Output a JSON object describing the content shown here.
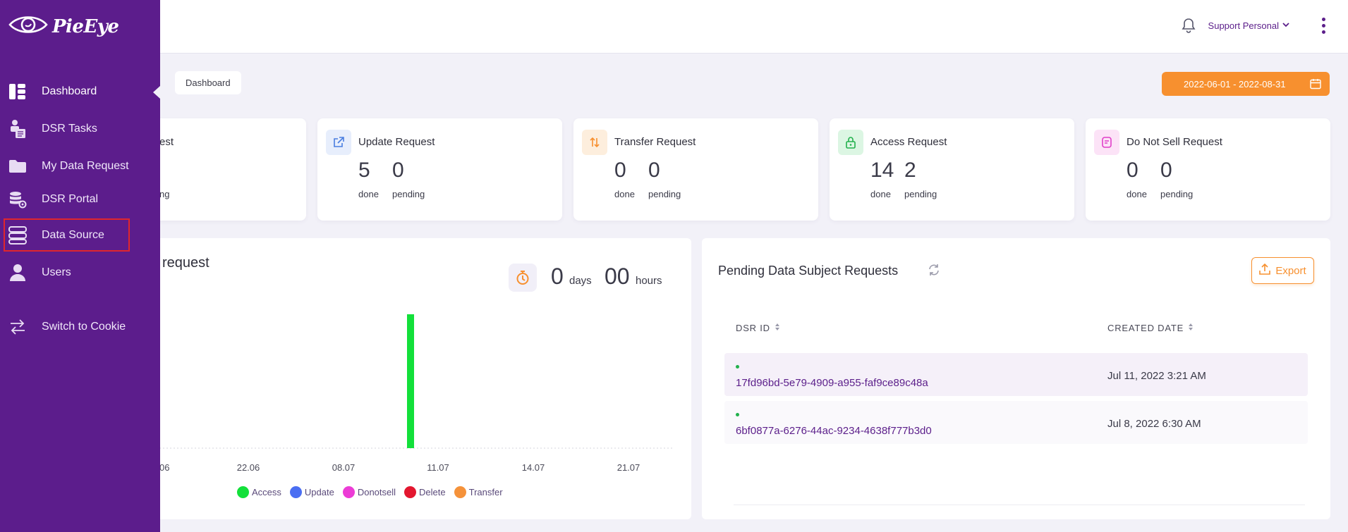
{
  "app": {
    "logo_text": "PieEye"
  },
  "header": {
    "user": "Support Personal"
  },
  "sidebar": {
    "items": [
      {
        "label": "Dashboard",
        "icon": "dashboard-icon"
      },
      {
        "label": "DSR Tasks",
        "icon": "tasks-icon"
      },
      {
        "label": "My Data Request",
        "icon": "folder-icon"
      },
      {
        "label": "DSR Portal",
        "icon": "database-gear-icon"
      },
      {
        "label": "Data Source",
        "icon": "data-source-icon"
      },
      {
        "label": "Users",
        "icon": "user-icon"
      },
      {
        "label": "Switch to Cookie",
        "icon": "switch-icon"
      }
    ]
  },
  "breadcrumb": "Dashboard",
  "date_range": "2022-06-01 - 2022-08-31",
  "cards": [
    {
      "title": "est",
      "done": "",
      "pending": "",
      "done_label": "",
      "pending_label": "ng"
    },
    {
      "title": "Update Request",
      "done": "5",
      "pending": "0",
      "done_label": "done",
      "pending_label": "pending",
      "icon": "external-link-icon",
      "color": "#4a7ee0"
    },
    {
      "title": "Transfer Request",
      "done": "0",
      "pending": "0",
      "done_label": "done",
      "pending_label": "pending",
      "icon": "transfer-arrows-icon",
      "color": "#f7902f"
    },
    {
      "title": "Access Request",
      "done": "14",
      "pending": "2",
      "done_label": "done",
      "pending_label": "pending",
      "icon": "lock-open-icon",
      "color": "#22b14c"
    },
    {
      "title": "Do Not Sell Request",
      "done": "0",
      "pending": "0",
      "done_label": "done",
      "pending_label": "pending",
      "icon": "note-icon",
      "color": "#e040c8"
    }
  ],
  "chart_panel": {
    "title": "request",
    "days_value": "0",
    "days_unit": "days",
    "hours_value": "00",
    "hours_unit": "hours"
  },
  "chart_data": {
    "type": "bar",
    "x_ticks": [
      "06",
      "22.06",
      "08.07",
      "11.07",
      "14.07",
      "21.07"
    ],
    "series": [
      {
        "name": "Access",
        "color": "#13e03a",
        "points": [
          {
            "x": "10.07",
            "value": 1
          }
        ]
      },
      {
        "name": "Update",
        "color": "#4a6ef2",
        "points": []
      },
      {
        "name": "Donotsell",
        "color": "#ec3cd6",
        "points": []
      },
      {
        "name": "Delete",
        "color": "#e3172f",
        "points": []
      },
      {
        "name": "Transfer",
        "color": "#f5923a",
        "points": []
      }
    ]
  },
  "pending": {
    "title": "Pending Data Subject Requests",
    "export_label": "Export",
    "columns": [
      "DSR ID",
      "CREATED DATE"
    ],
    "rows": [
      {
        "id": "17fd96bd-5e79-4909-a955-faf9ce89c48a",
        "date": "Jul 11, 2022 3:21 AM"
      },
      {
        "id": "6bf0877a-6276-44ac-9234-4638f777b3d0",
        "date": "Jul 8, 2022 6:30 AM"
      }
    ]
  }
}
